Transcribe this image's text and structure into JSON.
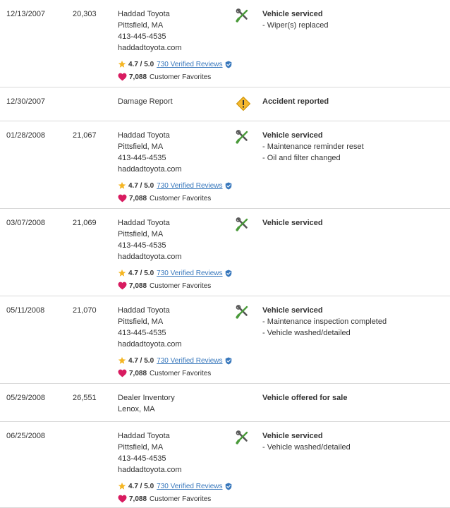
{
  "records": [
    {
      "date": "12/13/2007",
      "odometer": "20,303",
      "source": [
        "Haddad Toyota",
        "Pittsfield, MA",
        "413-445-4535",
        "haddadtoyota.com"
      ],
      "rating": "4.7 / 5.0",
      "reviews": "730 Verified Reviews",
      "favorites": "7,088",
      "favorites_label": "Customer Favorites",
      "icon": "wrench-screwdriver-icon",
      "event": "Vehicle serviced",
      "details": [
        "- Wiper(s) replaced"
      ]
    },
    {
      "date": "12/30/2007",
      "odometer": "",
      "source": [
        "Damage Report"
      ],
      "icon": "warning-diamond-icon",
      "event": "Accident reported",
      "details": []
    },
    {
      "date": "01/28/2008",
      "odometer": "21,067",
      "source": [
        "Haddad Toyota",
        "Pittsfield, MA",
        "413-445-4535",
        "haddadtoyota.com"
      ],
      "rating": "4.7 / 5.0",
      "reviews": "730 Verified Reviews",
      "favorites": "7,088",
      "favorites_label": "Customer Favorites",
      "icon": "wrench-screwdriver-icon",
      "event": "Vehicle serviced",
      "details": [
        "- Maintenance reminder reset",
        "- Oil and filter changed"
      ]
    },
    {
      "date": "03/07/2008",
      "odometer": "21,069",
      "source": [
        "Haddad Toyota",
        "Pittsfield, MA",
        "413-445-4535",
        "haddadtoyota.com"
      ],
      "rating": "4.7 / 5.0",
      "reviews": "730 Verified Reviews",
      "favorites": "7,088",
      "favorites_label": "Customer Favorites",
      "icon": "wrench-screwdriver-icon",
      "event": "Vehicle serviced",
      "details": []
    },
    {
      "date": "05/11/2008",
      "odometer": "21,070",
      "source": [
        "Haddad Toyota",
        "Pittsfield, MA",
        "413-445-4535",
        "haddadtoyota.com"
      ],
      "rating": "4.7 / 5.0",
      "reviews": "730 Verified Reviews",
      "favorites": "7,088",
      "favorites_label": "Customer Favorites",
      "icon": "wrench-screwdriver-icon",
      "event": "Vehicle serviced",
      "details": [
        "- Maintenance inspection completed",
        "- Vehicle washed/detailed"
      ]
    },
    {
      "date": "05/29/2008",
      "odometer": "26,551",
      "source": [
        "Dealer Inventory",
        "Lenox, MA"
      ],
      "icon": "",
      "event": "Vehicle offered for sale",
      "details": []
    },
    {
      "date": "06/25/2008",
      "odometer": "",
      "source": [
        "Haddad Toyota",
        "Pittsfield, MA",
        "413-445-4535",
        "haddadtoyota.com"
      ],
      "rating": "4.7 / 5.0",
      "reviews": "730 Verified Reviews",
      "favorites": "7,088",
      "favorites_label": "Customer Favorites",
      "icon": "wrench-screwdriver-icon",
      "event": "Vehicle serviced",
      "details": [
        "- Vehicle washed/detailed"
      ]
    }
  ],
  "colors": {
    "text": "#333333",
    "divider": "#d9d9d9",
    "link": "#3777bc",
    "star": "#f5b623",
    "heart": "#d81b60",
    "verified": "#3777bc",
    "tool_gray": "#555555",
    "tool_green": "#4a9a3a",
    "warning_fill": "#f5b82e",
    "warning_border": "#c98f00"
  }
}
